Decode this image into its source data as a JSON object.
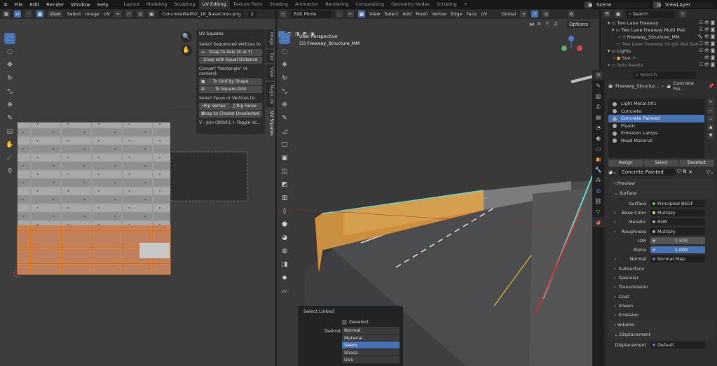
{
  "menu": [
    "File",
    "Edit",
    "Render",
    "Window",
    "Help"
  ],
  "workspaces": [
    "Layout",
    "Modeling",
    "Sculpting",
    "UV Editing",
    "Texture Paint",
    "Shading",
    "Animation",
    "Rendering",
    "Compositing",
    "Geometry Nodes",
    "Scripting"
  ],
  "active_workspace": "UV Editing",
  "scene": "Scene",
  "view_layer": "ViewLayer",
  "uv_header": {
    "menus": [
      "View",
      "Select",
      "Image",
      "UV"
    ],
    "image_name": "ConcreteWall02_1K_BaseColor.png",
    "users": "2"
  },
  "vp_header": {
    "mode": "Edit Mode",
    "menus": [
      "View",
      "Select",
      "Add",
      "Mesh",
      "Vertex",
      "Edge",
      "Face",
      "UV"
    ],
    "orientation": "Global",
    "options": "Options",
    "axes": [
      "X",
      "Y",
      "Z"
    ]
  },
  "viewport": {
    "view_name": "User Perspective",
    "object": "(3) Freeway_Structure_MM"
  },
  "uv_squares": {
    "title": "UV Squares",
    "label1": "Select Sequenced Vertices to:",
    "snap_axis": "Snap to Axis (X or Y)",
    "snap_equal": "Snap with Equal Distance",
    "label2": "Convert \"Rectangle\" (4 corners):",
    "grid_shape": "To Grid By Shape",
    "square_grid": "To Square Grid",
    "label3": "Select Faces or Vertices to:",
    "rip_vertex": "Rip Vertex",
    "rip_faces": "Rip Faces",
    "snap_closest": "Snap to Closest Unselected",
    "hint": "V - Join (Stitch), I -Toggle Isl..."
  },
  "sidebar_tabs": [
    "Image",
    "Tool",
    "View",
    "Magic UV",
    "UV Squares"
  ],
  "outliner": {
    "search": "Search",
    "items": [
      "Two Lane Freeway",
      "Two Lane Freeway Multi Mat",
      "Freeway_Structure_MM",
      "Two Lane Freeway Single Mat Bak",
      "Lights",
      "Sun",
      "Solo Assets"
    ]
  },
  "properties": {
    "search": "Search",
    "breadcrumb_object": "Freeway_Structur...",
    "breadcrumb_material": "Concrete Pai...",
    "materials": [
      "Light Metal.001",
      "Concrete",
      "Concrete Painted",
      "Plastic",
      "Emission Lamps",
      "Road Material"
    ],
    "assign": "Assign",
    "select": "Select",
    "deselect": "Deselect",
    "material_name": "Concrete Painted",
    "preview": "Preview",
    "surface_section": "Surface",
    "surface_rows": [
      {
        "k": "Surface",
        "v": "Principled BSDF"
      },
      {
        "k": "Base Color",
        "v": "Multiply"
      },
      {
        "k": "Metallic",
        "v": "RGB"
      },
      {
        "k": "Roughness",
        "v": "Multiply"
      },
      {
        "k": "IOR",
        "v": "1.500"
      },
      {
        "k": "Alpha",
        "v": "1.000"
      },
      {
        "k": "Normal",
        "v": "Normal Map"
      }
    ],
    "subsections": [
      "Subsurface",
      "Specular",
      "Transmission",
      "Coat",
      "Sheen",
      "Emission"
    ],
    "volume": "Volume",
    "displacement_section": "Displacement",
    "displacement_label": "Displacement",
    "displacement_value": "Default"
  },
  "select_linked": {
    "title": "Select Linked",
    "deselect": "Deselect",
    "delimit_label": "Delimit",
    "options": [
      "Normal",
      "Material",
      "Seam",
      "Sharp",
      "UVs"
    ],
    "selected": "Seam"
  },
  "colors": {
    "accent": "#4772b3",
    "orange": "#e8882a",
    "cyan": "#5fd9d0"
  }
}
